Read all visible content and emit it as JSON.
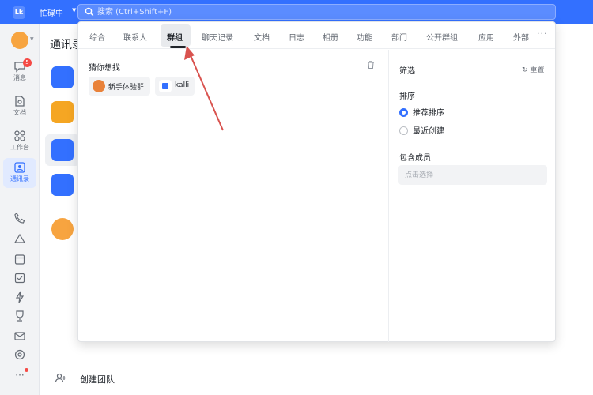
{
  "app": {
    "logo": "Lk",
    "name": "忙碌中"
  },
  "search": {
    "placeholder": "搜索 (Ctrl+Shift+F)"
  },
  "rail": {
    "items": [
      {
        "label": "消息",
        "badge": "5",
        "icon": "message-icon"
      },
      {
        "label": "文档",
        "icon": "document-icon"
      },
      {
        "label": "工作台",
        "icon": "workbench-icon"
      },
      {
        "label": "通讯录",
        "icon": "contacts-icon",
        "active": true
      }
    ],
    "more": "···"
  },
  "contacts": {
    "title": "通讯录",
    "create_team": "创建团队"
  },
  "tabs": [
    "综合",
    "联系人",
    "群组",
    "聊天记录",
    "文档",
    "日志",
    "相册",
    "功能",
    "部门",
    "公开群组",
    "应用",
    "外部"
  ],
  "active_tab": "群组",
  "guess": {
    "title": "猜你想找",
    "chips": [
      {
        "label": "新手体验群",
        "icon": "group-avatar-icon"
      },
      {
        "label": "kalli",
        "icon": "app-icon"
      }
    ]
  },
  "filter": {
    "title": "筛选",
    "reset": "重置",
    "sort_title": "排序",
    "sort_options": [
      {
        "label": "推荐排序",
        "checked": true
      },
      {
        "label": "最近创建",
        "checked": false
      }
    ],
    "member_title": "包含成员",
    "member_placeholder": "点击选择"
  },
  "colors": {
    "brand": "#3370ff",
    "annotation_arrow": "#d9534f",
    "badge": "#f54a45"
  }
}
